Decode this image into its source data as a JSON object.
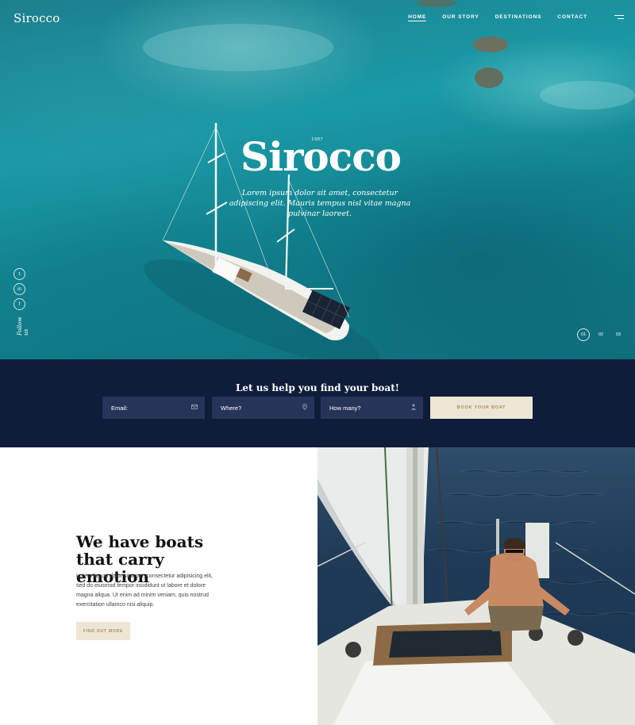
{
  "brand": {
    "logo": "Sirocco"
  },
  "nav": {
    "items": [
      {
        "label": "HOME",
        "active": true
      },
      {
        "label": "OUR STORY",
        "active": false
      },
      {
        "label": "DESTINATIONS",
        "active": false
      },
      {
        "label": "CONTACT",
        "active": false
      }
    ],
    "menu_icon": "hamburger-icon"
  },
  "hero": {
    "year": "1987",
    "title": "Sirocco",
    "subtitle": "Lorem ipsum dolor sit amet, consectetur adipiscing elit. Mauris tempus nisl vitae magna pulvinar laoreet.",
    "social_icons": [
      "twitter-icon",
      "linkedin-icon",
      "facebook-icon"
    ],
    "social_glyphs": [
      "t",
      "in",
      "f"
    ],
    "follow_label": "Follow us",
    "pager": [
      "01",
      "02",
      "03"
    ],
    "active_slide": "01"
  },
  "booking": {
    "title": "Let us help you find your boat!",
    "fields": [
      {
        "label": "Email:",
        "icon": "mail-icon"
      },
      {
        "label": "Where?",
        "icon": "location-pin-icon"
      },
      {
        "label": "How many?",
        "icon": "person-icon"
      }
    ],
    "button_label": "BOOK YOUR BOAT"
  },
  "intro": {
    "title": "We have boats that carry emotion",
    "text": "Lorem ipsum dolor sit amet, consectetur adipisicing elit, sed do eiusmod tempor incididunt ut labore et dolore magna aliqua. Ut enim ad minim veniam, quis nostrud exercitation ullamco nisi aliquip.",
    "button_label": "FIND OUT MORE"
  },
  "colors": {
    "booking_bg": "#0f1d3b",
    "field_bg": "#26345a",
    "button_bg": "#ede6d6",
    "button_text": "#b08b52",
    "hero_sea": "#1a9aa6"
  }
}
